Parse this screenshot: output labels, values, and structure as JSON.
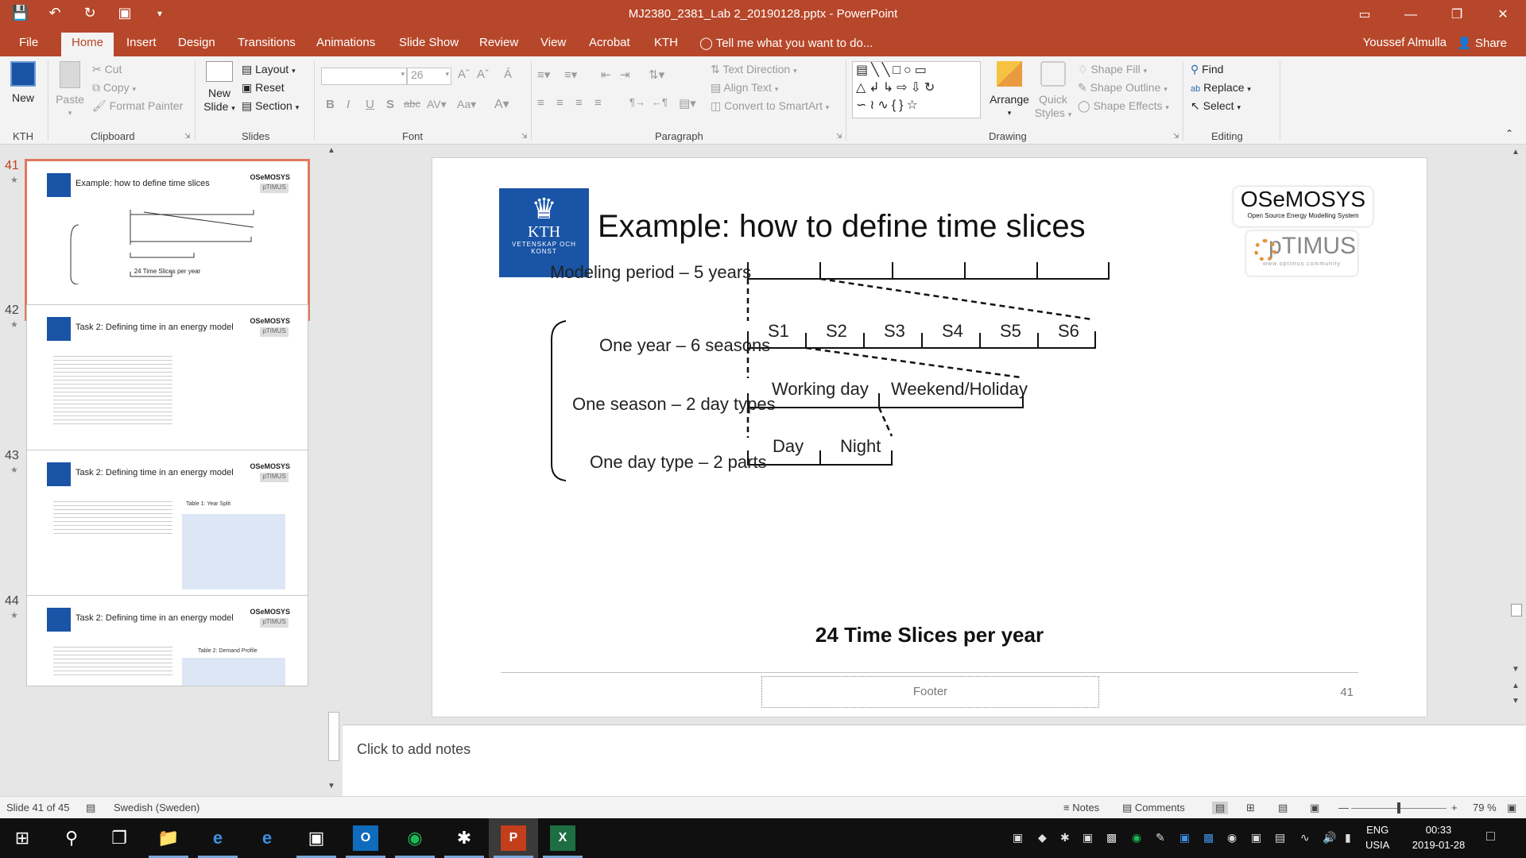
{
  "titlebar": {
    "title": "MJ2380_2381_Lab 2_20190128.pptx - PowerPoint",
    "qat_icons": [
      "save-icon",
      "undo-icon",
      "redo-icon",
      "present-icon",
      "customize-icon"
    ],
    "ribbon_display_glyph": "▭",
    "minimize_glyph": "—",
    "restore_glyph": "❐",
    "close_glyph": "✕"
  },
  "tabs": {
    "items": [
      {
        "label": "File"
      },
      {
        "label": "Home"
      },
      {
        "label": "Insert"
      },
      {
        "label": "Design"
      },
      {
        "label": "Transitions"
      },
      {
        "label": "Animations"
      },
      {
        "label": "Slide Show"
      },
      {
        "label": "Review"
      },
      {
        "label": "View"
      },
      {
        "label": "Acrobat"
      },
      {
        "label": "KTH"
      }
    ],
    "active": "Home",
    "tell_me": "Tell me what you want to do...",
    "user": "Youssef Almulla",
    "share": "Share"
  },
  "ribbon": {
    "kth": {
      "new_label": "New",
      "group": "KTH"
    },
    "clipboard": {
      "paste": "Paste",
      "cut": "Cut",
      "copy": "Copy",
      "format_painter": "Format Painter",
      "group": "Clipboard"
    },
    "slides": {
      "new_slide_line1": "New",
      "new_slide_line2": "Slide",
      "layout": "Layout",
      "reset": "Reset",
      "section": "Section",
      "group": "Slides"
    },
    "font": {
      "font_name": "",
      "font_size": "26",
      "group": "Font"
    },
    "paragraph": {
      "text_direction": "Text Direction",
      "align_text": "Align Text",
      "convert_smartart": "Convert to SmartArt",
      "group": "Paragraph"
    },
    "drawing": {
      "arrange": "Arrange",
      "quick_styles_line1": "Quick",
      "quick_styles_line2": "Styles",
      "shape_fill": "Shape Fill",
      "shape_outline": "Shape Outline",
      "shape_effects": "Shape Effects",
      "group": "Drawing"
    },
    "editing": {
      "find": "Find",
      "replace": "Replace",
      "select": "Select",
      "group": "Editing"
    }
  },
  "thumbnails": [
    {
      "number": "41",
      "title": "Example: how to define time slices",
      "active": true,
      "summary": "24 Time Slices per year"
    },
    {
      "number": "42",
      "title": "Task 2: Defining time in an energy model",
      "active": false
    },
    {
      "number": "43",
      "title": "Task 2: Defining time in an energy model",
      "active": false,
      "table_label": "Table 1: Year Split"
    },
    {
      "number": "44",
      "title": "Task 2: Defining time in an energy model",
      "active": false,
      "table_label": "Table 2: Demand Profile"
    }
  ],
  "slide": {
    "title": "Example: how to define time slices",
    "kth_logo": {
      "text": "KTH",
      "subtext": "VETENSKAP OCH KONST"
    },
    "osemosys": {
      "name": "OSeMOSYS",
      "tagline": "Open Source Energy Modelling System"
    },
    "optimus": {
      "name": "pTIMUS",
      "url": "www.optimus.community"
    },
    "labels": {
      "modeling_period": "Modeling period   – 5  years",
      "one_year": "One year – 6 seasons",
      "one_season": "One season – 2 day types",
      "one_day_type": "One day type – 2 parts"
    },
    "seasons": [
      "S1",
      "S2",
      "S3",
      "S4",
      "S5",
      "S6"
    ],
    "day_types": [
      "Working day",
      "Weekend/Holiday"
    ],
    "day_parts": [
      "Day",
      "Night"
    ],
    "summary": "24 Time Slices per year",
    "footer": "Footer",
    "slide_number": "41"
  },
  "notes_placeholder": "Click to add notes",
  "statusbar": {
    "slide_info": "Slide 41 of 45",
    "language": "Swedish (Sweden)",
    "notes": "Notes",
    "comments": "Comments",
    "zoom": "79 %",
    "zoom_level": 0.79
  },
  "taskbar": {
    "apps": [
      "start-icon",
      "search-icon",
      "task-view-icon",
      "file-explorer-icon",
      "internet-explorer-icon",
      "edge-icon",
      "sticky-notes-icon",
      "outlook-icon",
      "spotify-icon",
      "slack-icon",
      "powerpoint-icon",
      "excel-icon"
    ],
    "lang_line1": "ENG",
    "lang_line2": "USIA",
    "time": "00:33",
    "date": "2019-01-28"
  },
  "colors": {
    "accent": "#b7472a",
    "kth_blue": "#1954a6",
    "thumb_active_border": "#e0795c"
  }
}
